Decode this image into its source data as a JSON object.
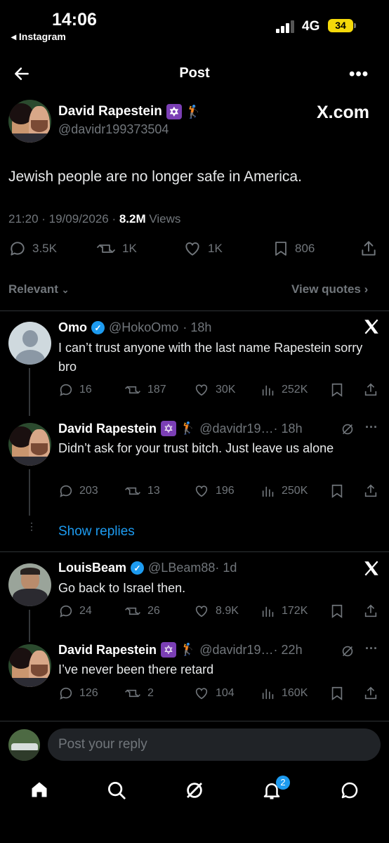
{
  "status_bar": {
    "time": "14:06",
    "back_app": "◂ Instagram",
    "network": "4G",
    "battery": "34"
  },
  "nav": {
    "title": "Post",
    "back_icon": "arrow-left-icon",
    "more": "•••"
  },
  "main_post": {
    "author_name": "David Rapestein",
    "author_handle": "@davidr199373504",
    "source": "X.com",
    "text": "Jewish people are no longer safe in America.",
    "time": "21:20 · 19/09/2026 · ",
    "views_count": "8.2M",
    "views_label": " Views",
    "replies": "3.5K",
    "reposts": "1K",
    "likes": "1K",
    "bookmarks": "806"
  },
  "filters": {
    "sort": "Relevant",
    "quotes": "View quotes"
  },
  "replies": [
    {
      "name": "Omo",
      "handle": "@HokoOmo",
      "age": " · 18h",
      "text": "I can’t trust anyone with the last name Rapestein sorry bro",
      "replies": "16",
      "reposts": "187",
      "likes": "30K",
      "views": "252K"
    },
    {
      "name": "David Rapestein",
      "handle": "@davidr19…",
      "age": " · 18h",
      "text": "Didn’t ask for your trust bitch. Just leave us alone",
      "replies": "203",
      "reposts": "13",
      "likes": "196",
      "views": "250K"
    },
    {
      "name": "LouisBeam",
      "handle": "@LBeam88",
      "age": " · 1d",
      "text": "Go back to Israel then.",
      "replies": "24",
      "reposts": "26",
      "likes": "8.9K",
      "views": "172K"
    },
    {
      "name": "David Rapestein",
      "handle": "@davidr19…",
      "age": " · 22h",
      "text": "I’ve never been there retard",
      "replies": "126",
      "reposts": "2",
      "likes": "104",
      "views": "160K"
    }
  ],
  "show_replies": "Show replies",
  "composer": {
    "placeholder": "Post your reply"
  },
  "tab_bar": {
    "notifications_badge": "2"
  },
  "colors": {
    "accent": "#1d9bf0",
    "background": "#000000",
    "muted": "#71767b"
  }
}
